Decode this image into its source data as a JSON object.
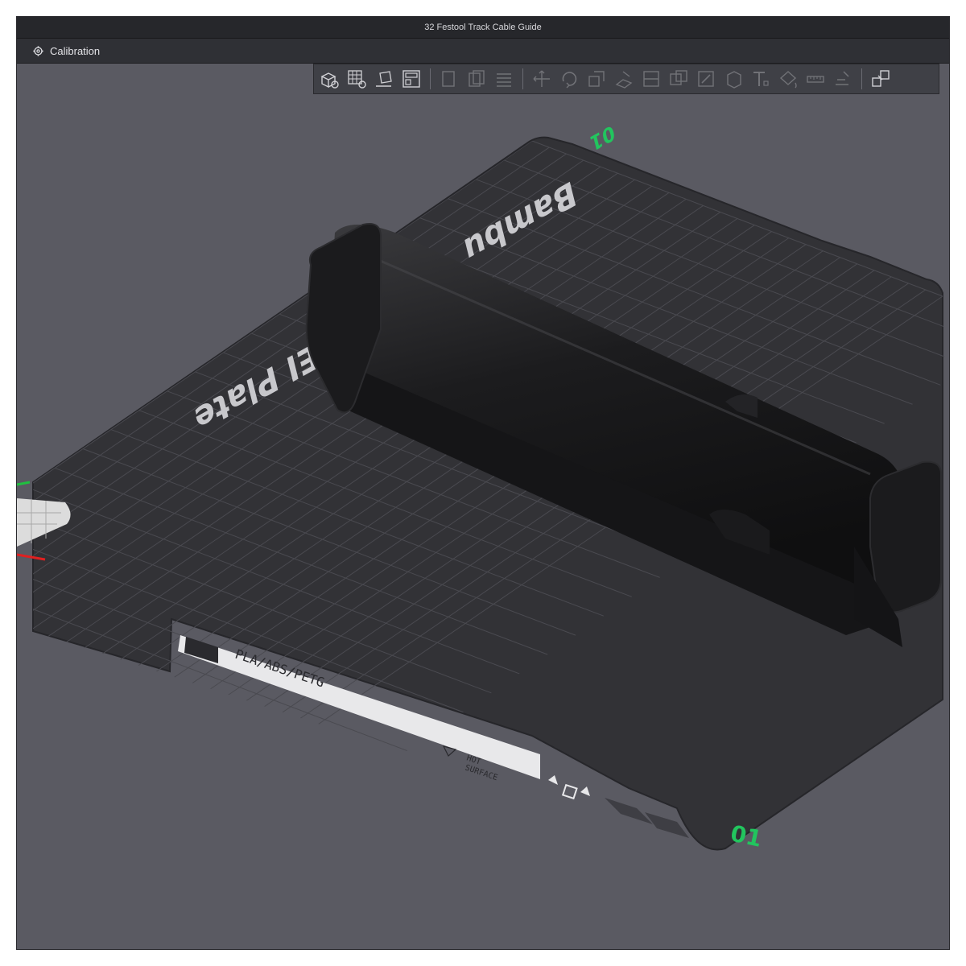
{
  "window": {
    "title": "32 Festool Track Cable Guide"
  },
  "menu": {
    "calibration_label": "Calibration",
    "calibration_icon": "gear-icon"
  },
  "toolbar": {
    "tools": [
      {
        "name": "add-object-button",
        "icon": "add-cube-icon"
      },
      {
        "name": "add-plate-button",
        "icon": "add-plate-icon"
      },
      {
        "name": "auto-orient-button",
        "icon": "auto-orient-icon"
      },
      {
        "name": "arrange-button",
        "icon": "arrange-icon"
      },
      {
        "name": "copy-button",
        "icon": "copy-icon"
      },
      {
        "name": "paste-button",
        "icon": "paste-icon"
      },
      {
        "name": "layers-button",
        "icon": "layers-icon"
      },
      {
        "name": "move-button",
        "icon": "move-icon"
      },
      {
        "name": "rotate-button",
        "icon": "rotate-icon"
      },
      {
        "name": "scale-button",
        "icon": "scale-icon"
      },
      {
        "name": "lay-on-face-button",
        "icon": "lay-on-face-icon"
      },
      {
        "name": "cut-button",
        "icon": "cut-icon"
      },
      {
        "name": "boolean-button",
        "icon": "boolean-icon"
      },
      {
        "name": "support-paint-button",
        "icon": "support-paint-icon"
      },
      {
        "name": "seam-paint-button",
        "icon": "seam-paint-icon"
      },
      {
        "name": "text-button",
        "icon": "text-icon"
      },
      {
        "name": "color-paint-button",
        "icon": "color-paint-icon"
      },
      {
        "name": "measure-button",
        "icon": "measure-icon"
      },
      {
        "name": "assembly-button",
        "icon": "assembly-icon"
      },
      {
        "name": "explode-button",
        "icon": "explode-icon"
      }
    ]
  },
  "plate": {
    "brand_text": "Bambu",
    "plate_text": "PEI Plate",
    "material_text": "PLA/ABS/PETG",
    "warning_line1": "HOT",
    "warning_line2": "SURFACE",
    "plate_number": "01",
    "plate_number_back": "01"
  },
  "colors": {
    "background": "#5a5a62",
    "plate": "#323236",
    "grid": "#4b4b50",
    "model": "#1e1e20",
    "axis_x": "#e02020",
    "axis_y": "#20c040",
    "plate_number": "#22c55e"
  }
}
